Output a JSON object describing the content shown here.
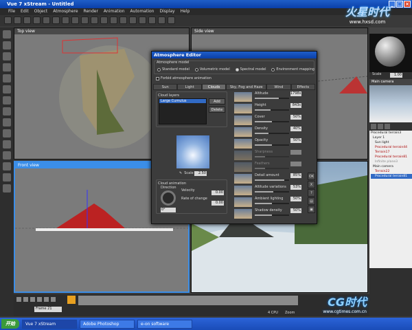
{
  "app": {
    "title": "Vue 7 xStream - Untitled"
  },
  "menu": [
    "File",
    "Edit",
    "Object",
    "Atmosphere",
    "Render",
    "Animation",
    "Automation",
    "Display",
    "Help"
  ],
  "brand": {
    "name": "火星时代",
    "url": "www.hxsd.com"
  },
  "viewports": {
    "top": "Top view",
    "side": "Side view",
    "front": "Front view"
  },
  "dialog": {
    "title": "Atmosphere Editor",
    "model_group": "Atmosphere model",
    "models": [
      "Standard model",
      "Volumetric model",
      "Spectral model",
      "Environment mapping"
    ],
    "forbid": "Forbid atmosphere animation",
    "tabs": [
      "Sun",
      "Light",
      "Clouds",
      "Sky, Fog and Haze",
      "Wind",
      "Effects"
    ],
    "active_tab": "Clouds",
    "layers_label": "Cloud layers",
    "layer_item": "Large Cumulus",
    "add": "Add",
    "delete": "Delete",
    "scale_label": "Scale",
    "scale_value": "2.50",
    "anim_label": "Cloud animation",
    "direction": "Direction",
    "velocity": "Velocity",
    "velocity_val": "0.00",
    "rate": "Rate of change",
    "rate_val": "0.00",
    "angle": "0°",
    "params": [
      {
        "label": "Altitude",
        "value": "1798s",
        "pct": 70,
        "disabled": false
      },
      {
        "label": "Height",
        "value": "843s",
        "pct": 45,
        "disabled": false
      },
      {
        "label": "Cover",
        "value": "50%",
        "pct": 50,
        "disabled": false
      },
      {
        "label": "Density",
        "value": "40%",
        "pct": 40,
        "disabled": false
      },
      {
        "label": "Opacity",
        "value": "50%",
        "pct": 50,
        "disabled": false
      },
      {
        "label": "Sharpness",
        "value": "",
        "pct": 30,
        "disabled": true
      },
      {
        "label": "Feathers",
        "value": "",
        "pct": 30,
        "disabled": true
      },
      {
        "label": "Detail amount",
        "value": "85%",
        "pct": 85,
        "disabled": false
      },
      {
        "label": "Altitude variations",
        "value": "53%",
        "pct": 53,
        "disabled": false
      },
      {
        "label": "Ambient lighting",
        "value": "50%",
        "pct": 50,
        "disabled": false
      },
      {
        "label": "Shadow density",
        "value": "50%",
        "pct": 50,
        "disabled": false
      }
    ],
    "ok": "OK",
    "cancel": "X"
  },
  "right": {
    "scale_label": "Scale",
    "scale_val": "1.00",
    "camera": "Main camera",
    "tree": [
      "Procedural terrain3",
      "Layer 1",
      "Sun light",
      "Procedural terrain44",
      "Terrain17",
      "Procedural terrain81",
      "Infinite plane3",
      "Main camera",
      "Terrain22",
      "Procedural terrain81"
    ]
  },
  "timeline": {
    "frame": "Frame 21",
    "cpu": "4 CPU",
    "zoom": "Zoom"
  },
  "taskbar": {
    "start": "开始",
    "tasks": [
      "Vue 7 xStream",
      "Adobe Photoshop",
      "e-on software"
    ]
  },
  "watermark": {
    "name": "CG时代",
    "url": "www.cgtimes.com.cn"
  }
}
